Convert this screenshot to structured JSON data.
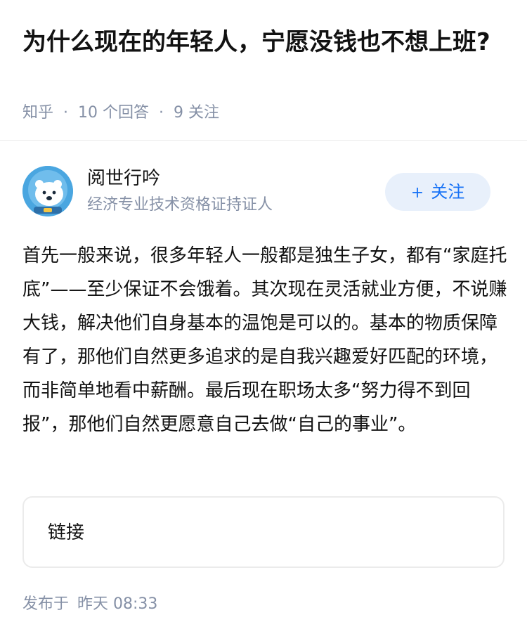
{
  "question": {
    "title": "为什么现在的年轻人，宁愿没钱也不想上班?",
    "source": "知乎",
    "separator": "·",
    "answers_count": "10 个回答",
    "followers_count": "9 关注"
  },
  "author": {
    "name": "阅世行吟",
    "title": "经济专业技术资格证持证人",
    "follow_label": "关注",
    "follow_icon": "+",
    "avatar_icon": "polar-bear-astronaut-avatar"
  },
  "answer": {
    "text": "首先一般来说，很多年轻人一般都是独生子女，都有“家庭托底”——至少保证不会饿着。其次现在灵活就业方便，不说赚大钱，解决他们自身基本的温饱是可以的。基本的物质保障有了，那他们自然更多追求的是自我兴趣爱好匹配的环境，而非简单地看中薪酬。最后现在职场太多“努力得不到回报”，那他们自然更愿意自己去做“自己的事业”。"
  },
  "link_card": {
    "label": "链接"
  },
  "publish": {
    "label": "发布于",
    "time": "昨天 08:33"
  },
  "colors": {
    "primary": "#1772f6",
    "follow_bg": "#e8f0fb",
    "meta_text": "#8590a6"
  }
}
